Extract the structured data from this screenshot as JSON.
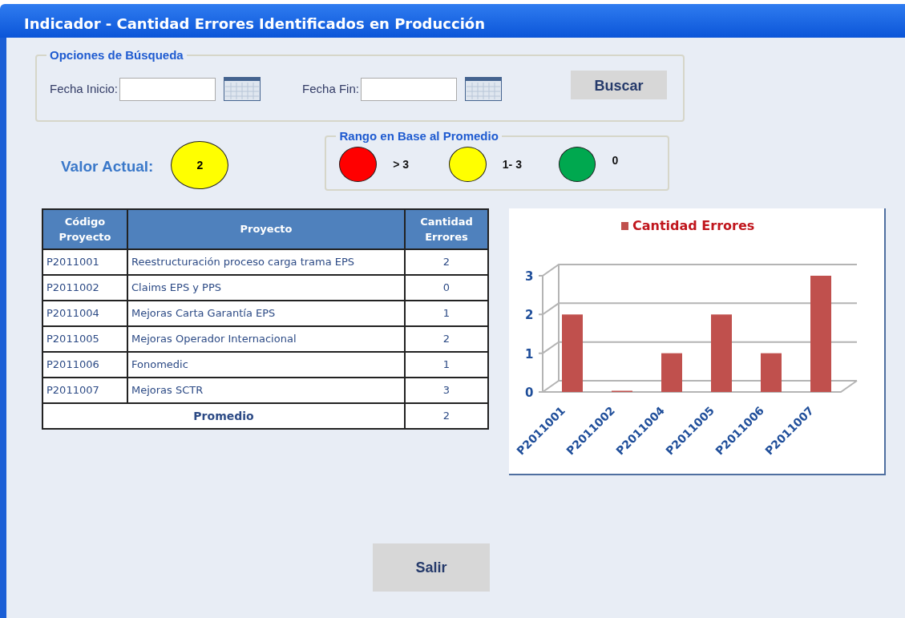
{
  "window": {
    "title": "Indicador - Cantidad Errores Identificados en Producción"
  },
  "search": {
    "legend": "Opciones de Búsqueda",
    "start_label": "Fecha Inicio:",
    "end_label": "Fecha Fin:",
    "button": "Buscar"
  },
  "current": {
    "label": "Valor Actual:",
    "value": "2",
    "color": "#ffff00"
  },
  "range": {
    "legend": "Rango en Base al Promedio",
    "items": [
      {
        "label": "> 3",
        "color": "#ff0000"
      },
      {
        "label": "1- 3",
        "color": "#ffff00"
      },
      {
        "label": "0",
        "color": "#00a84f"
      }
    ]
  },
  "table": {
    "columns": [
      "Código Proyecto",
      "Proyecto",
      "Cantidad Errores"
    ],
    "rows": [
      [
        "P2011001",
        "Reestructuración proceso carga trama EPS",
        "2"
      ],
      [
        "P2011002",
        "Claims EPS y PPS",
        "0"
      ],
      [
        "P2011004",
        "Mejoras Carta Garantía EPS",
        "1"
      ],
      [
        "P2011005",
        "Mejoras Operador Internacional",
        "2"
      ],
      [
        "P2011006",
        "Fonomedic",
        "1"
      ],
      [
        "P2011007",
        "Mejoras SCTR",
        "3"
      ]
    ],
    "footer": {
      "label": "Promedio",
      "value": "2"
    }
  },
  "chart": {
    "chart_data": {
      "type": "bar",
      "categories": [
        "P2011001",
        "P2011002",
        "P2011004",
        "P2011005",
        "P2011006",
        "P2011007"
      ],
      "series": [
        {
          "name": "Cantidad Errores",
          "color": "#c0504d",
          "values": [
            2,
            0,
            1,
            2,
            1,
            3
          ]
        }
      ],
      "ylim": [
        0,
        3
      ],
      "yticks": [
        0,
        1,
        2,
        3
      ]
    }
  },
  "exit_button": "Salir"
}
